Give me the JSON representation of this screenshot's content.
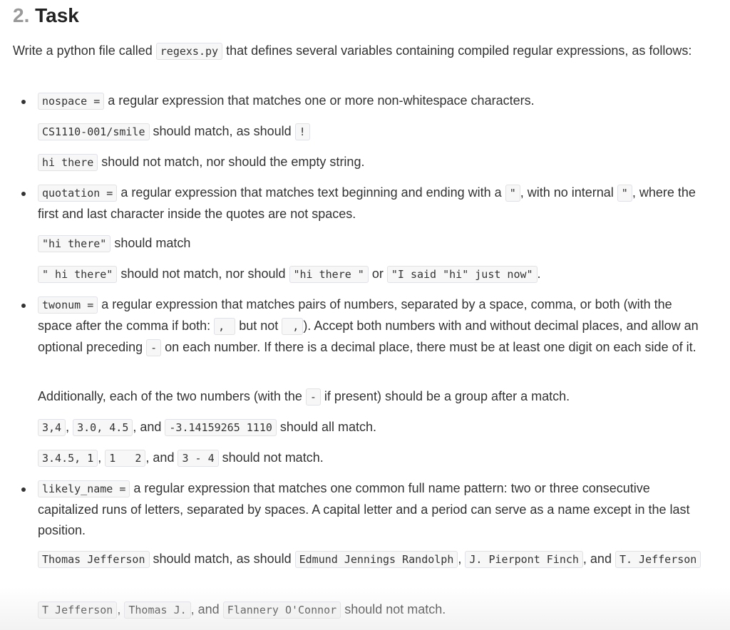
{
  "heading": {
    "number": "2.",
    "title": "Task"
  },
  "intro": {
    "before": "Write a python file called ",
    "filename": "regexs.py",
    "after": " that defines several variables containing compiled regular expressions, as follows:"
  },
  "items": [
    {
      "var": "nospace =",
      "desc": " a regular expression that matches one or more non-whitespace characters.",
      "match_line": {
        "c1": "CS1110-001/smile",
        "t1": " should match, as should ",
        "c2": "!"
      },
      "nomatch_line": {
        "c1": "hi there",
        "t1": " should not match, nor should the empty string."
      }
    },
    {
      "var": "quotation =",
      "desc_a": " a regular expression that matches text beginning and ending with a ",
      "q1": "\"",
      "desc_b": ", with no internal ",
      "q2": "\"",
      "desc_c": ", where the first and last character inside the quotes are not spaces.",
      "match_line": {
        "c1": "\"hi there\"",
        "t1": " should match"
      },
      "nomatch_line": {
        "c1": "\" hi there\"",
        "t1": " should not match, nor should ",
        "c2": "\"hi there \"",
        "t2": " or ",
        "c3": "\"I said \"hi\" just now\"",
        "t3": "."
      }
    },
    {
      "var": "twonum =",
      "desc_a": " a regular expression that matches pairs of numbers, separated by a space, comma, or both (with the space after the comma if both: ",
      "c_good": ", ",
      "desc_b": " but not ",
      "c_bad": " ,",
      "desc_c": "). Accept both numbers with and without decimal places, and allow an optional preceding ",
      "c_minus": "-",
      "desc_d": " on each number. If there is a decimal place, there must be at least one digit on each side of it.",
      "group_line": {
        "t0": "Additionally, each of the two numbers (with the ",
        "c1": "-",
        "t1": " if present) should be a group after a match."
      },
      "match_line": {
        "c1": "3,4",
        "t1": ", ",
        "c2": "3.0, 4.5",
        "t2": ", and ",
        "c3": "-3.14159265 1110",
        "t3": " should all match."
      },
      "nomatch_line": {
        "c1": "3.4.5, 1",
        "t1": ", ",
        "c2": "1   2",
        "t2": ", and ",
        "c3": "3 - 4",
        "t3": " should not match."
      }
    },
    {
      "var": "likely_name =",
      "desc": " a regular expression that matches one common full name pattern: two or three consecutive capitalized runs of letters, separated by spaces. A capital letter and a period can serve as a name except in the last position.",
      "match_line": {
        "c1": "Thomas Jefferson",
        "t1": " should match, as should ",
        "c2": "Edmund Jennings Randolph",
        "t2": ", ",
        "c3": "J. Pierpont Finch",
        "t3": ", and ",
        "c4": "T. Jefferson"
      },
      "nomatch_line": {
        "c1": "T Jefferson",
        "t1": ", ",
        "c2": "Thomas J.",
        "t2": ", and ",
        "c3": "Flannery O'Connor",
        "t3": " should not match."
      }
    }
  ]
}
